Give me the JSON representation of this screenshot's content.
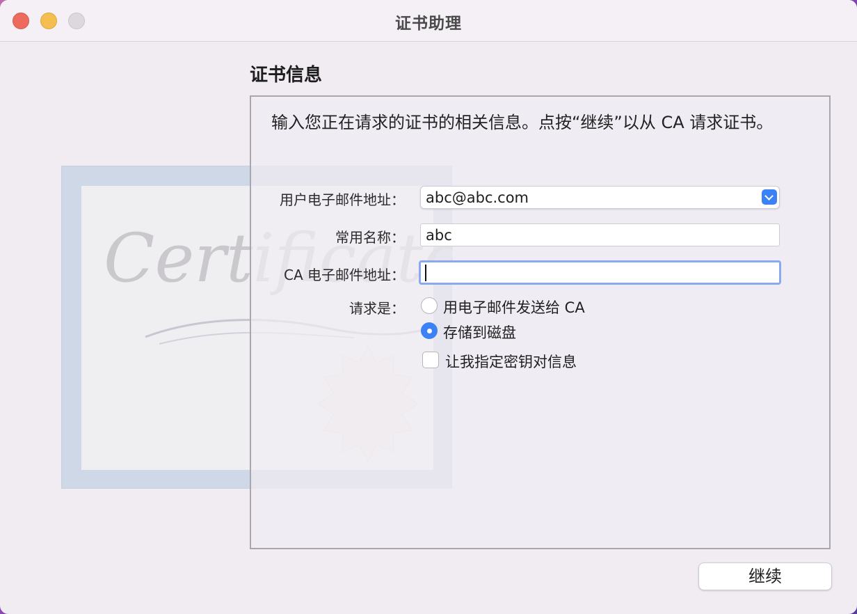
{
  "window": {
    "title": "证书助理"
  },
  "illustration": {
    "label": "Certificate"
  },
  "section": {
    "title": "证书信息",
    "intro": "输入您正在请求的证书的相关信息。点按“继续”以从 CA 请求证书。"
  },
  "form": {
    "email_label": "用户电子邮件地址：",
    "email_value": "abc@abc.com",
    "common_name_label": "常用名称：",
    "common_name_value": "abc",
    "ca_email_label": "CA 电子邮件地址：",
    "ca_email_value": "",
    "request_label": "请求是：",
    "option_email_ca": "用电子邮件发送给 CA",
    "option_save_disk": "存储到磁盘",
    "selected_option": "option_save_disk",
    "let_me_specify": "让我指定密钥对信息",
    "let_me_specify_checked": false
  },
  "footer": {
    "continue_label": "继续"
  },
  "colors": {
    "accent": "#3b82f6",
    "focus_ring": "#8aa9ef",
    "close": "#ec6a5e",
    "minimize": "#f4bf4f",
    "zoom": "#dcd8dd"
  }
}
